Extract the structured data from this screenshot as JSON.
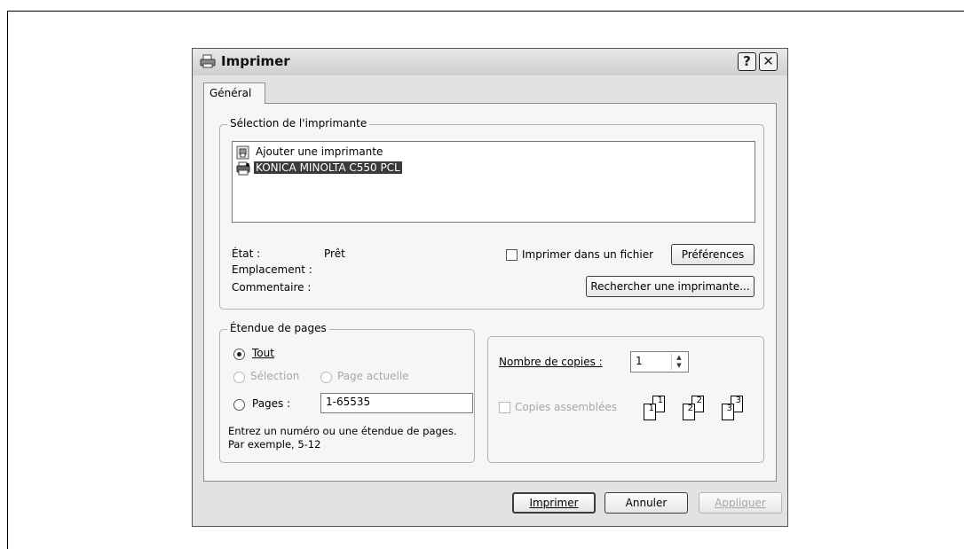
{
  "dialog": {
    "title": "Imprimer",
    "help_label": "?",
    "close_label": "✕"
  },
  "tabs": [
    {
      "label": "Général"
    }
  ],
  "printer_selection": {
    "group_label": "Sélection de l'imprimante",
    "printers": [
      {
        "name": "Ajouter une imprimante",
        "selected": false
      },
      {
        "name": "KONICA MINOLTA C550 PCL",
        "selected": true
      }
    ],
    "status_label": "État :",
    "status_value": "Prêt",
    "location_label": "Emplacement :",
    "comment_label": "Commentaire :",
    "print_to_file_label": "Imprimer dans un fichier",
    "print_to_file_checked": false,
    "preferences_button": "Préférences",
    "find_printer_button": "Rechercher une imprimante..."
  },
  "page_range": {
    "group_label": "Étendue de pages",
    "all_label": "Tout",
    "selection_label": "Sélection",
    "current_page_label": "Page actuelle",
    "pages_label": "Pages :",
    "pages_value": "1-65535",
    "hint_line1": "Entrez un numéro ou une étendue de pages.",
    "hint_line2": "Par exemple, 5-12",
    "selected_option": "all"
  },
  "copies": {
    "count_label": "Nombre de copies :",
    "count_value": "1",
    "collate_label": "Copies assemblées",
    "collate_checked": false,
    "collate_pages": [
      "1",
      "1",
      "2",
      "2",
      "3",
      "3"
    ]
  },
  "footer": {
    "print_button": "Imprimer",
    "cancel_button": "Annuler",
    "apply_button": "Appliquer"
  }
}
